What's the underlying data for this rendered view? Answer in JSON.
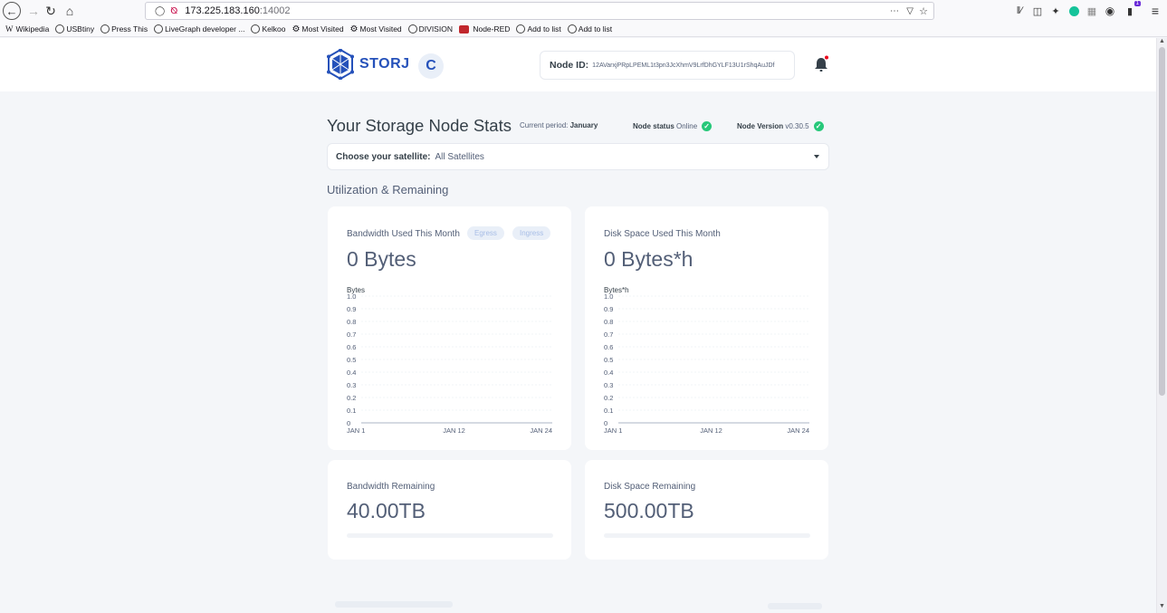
{
  "browser": {
    "url_host": "173.225.183.160",
    "url_port": ":14002",
    "bookmarks": [
      "Wikipedia",
      "USBtiny",
      "Press This",
      "LiveGraph developer ...",
      "Kelkoo",
      "Most Visited",
      "Most Visited",
      "DIVISION",
      "Node-RED",
      "Add to list",
      "Add to list"
    ],
    "menu_icon": "≡",
    "extension_badge": "1"
  },
  "header": {
    "logo_text": "STORJ",
    "node_id_label": "Node ID:",
    "node_id_value": "12AVarxjPRpLPEML1t3pn3JcXhmV9LrfDhGYLF13U1rShqAuJDf"
  },
  "stats": {
    "title": "Your Storage Node Stats",
    "period_label": "Current period:",
    "period_value": "January",
    "status_label": "Node status",
    "status_value": "Online",
    "version_label": "Node Version",
    "version_value": "v0.30.5"
  },
  "satellite": {
    "label": "Choose your satellite:",
    "value": "All Satellites"
  },
  "section": {
    "title": "Utilization & Remaining"
  },
  "bandwidth": {
    "title": "Bandwidth Used This Month",
    "egress": "Egress",
    "ingress": "Ingress",
    "value": "0 Bytes"
  },
  "disk": {
    "title": "Disk Space Used This Month",
    "value": "0 Bytes*h"
  },
  "bandwidth_remaining": {
    "title": "Bandwidth Remaining",
    "value": "40.00TB",
    "used_fraction": 0
  },
  "disk_remaining": {
    "title": "Disk Space Remaining",
    "value": "500.00TB",
    "used_fraction": 0
  },
  "colors": {
    "brand": "#2551ba",
    "online": "#27c87a",
    "bell_dot": "#eb001b"
  },
  "chart_data": [
    {
      "type": "line",
      "ylabel": "Bytes",
      "ylim": [
        0,
        1.0
      ],
      "y_ticks": [
        "1.0",
        "0.9",
        "0.8",
        "0.7",
        "0.6",
        "0.5",
        "0.4",
        "0.3",
        "0.2",
        "0.1",
        "0"
      ],
      "x_ticks": [
        "JAN 1",
        "JAN 12",
        "JAN 24"
      ],
      "series": []
    },
    {
      "type": "line",
      "ylabel": "Bytes*h",
      "ylim": [
        0,
        1.0
      ],
      "y_ticks": [
        "1.0",
        "0.9",
        "0.8",
        "0.7",
        "0.6",
        "0.5",
        "0.4",
        "0.3",
        "0.2",
        "0.1",
        "0"
      ],
      "x_ticks": [
        "JAN 1",
        "JAN 12",
        "JAN 24"
      ],
      "series": []
    }
  ]
}
